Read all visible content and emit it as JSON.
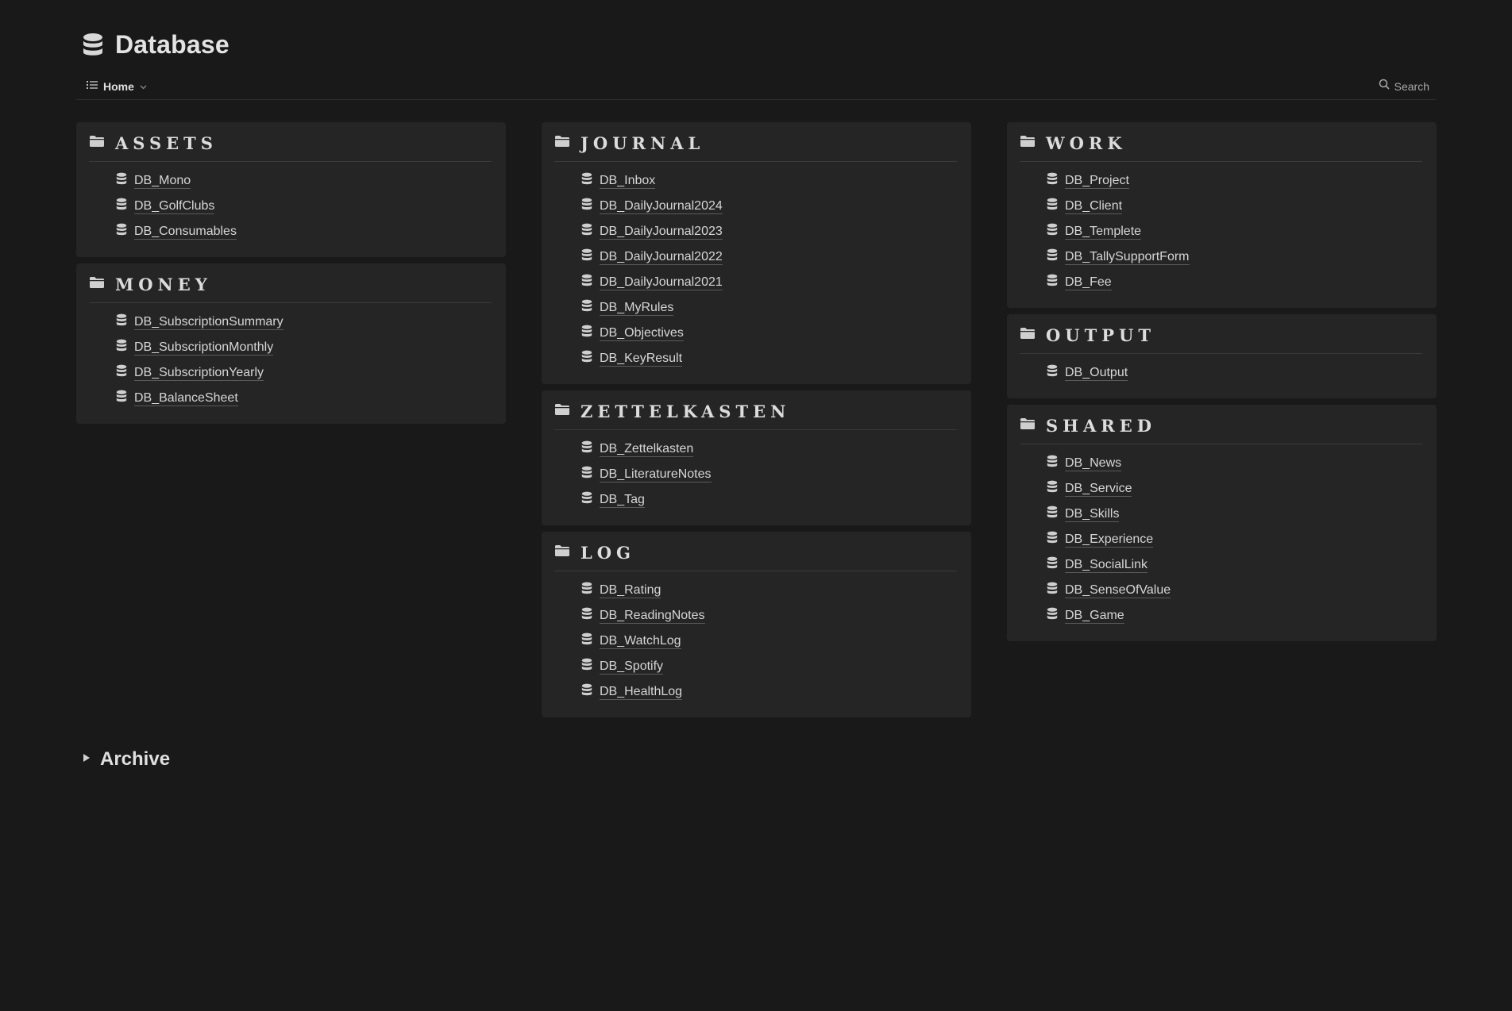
{
  "page": {
    "title": "Database",
    "icon": "database-icon"
  },
  "viewbar": {
    "tab_label": "Home",
    "tab_icon": "list-icon",
    "search_label": "Search",
    "search_icon": "search-icon"
  },
  "columns": [
    {
      "cards": [
        {
          "title": "ASSETS",
          "icon": "folder-icon",
          "items": [
            "DB_Mono",
            "DB_GolfClubs",
            "DB_Consumables"
          ]
        },
        {
          "title": "MONEY",
          "icon": "folder-icon",
          "items": [
            "DB_SubscriptionSummary",
            "DB_SubscriptionMonthly",
            "DB_SubscriptionYearly",
            "DB_BalanceSheet"
          ]
        }
      ]
    },
    {
      "cards": [
        {
          "title": "JOURNAL",
          "icon": "folder-icon",
          "items": [
            "DB_Inbox",
            "DB_DailyJournal2024",
            "DB_DailyJournal2023",
            "DB_DailyJournal2022",
            "DB_DailyJournal2021",
            "DB_MyRules",
            "DB_Objectives",
            "DB_KeyResult"
          ]
        },
        {
          "title": "ZETTELKASTEN",
          "icon": "folder-icon",
          "items": [
            "DB_Zettelkasten",
            "DB_LiteratureNotes",
            "DB_Tag"
          ]
        },
        {
          "title": "LOG",
          "icon": "folder-icon",
          "items": [
            "DB_Rating",
            "DB_ReadingNotes",
            "DB_WatchLog",
            "DB_Spotify",
            "DB_HealthLog"
          ]
        }
      ]
    },
    {
      "cards": [
        {
          "title": "WORK",
          "icon": "folder-icon",
          "items": [
            "DB_Project",
            "DB_Client",
            "DB_Templete",
            "DB_TallySupportForm",
            "DB_Fee"
          ]
        },
        {
          "title": "OUTPUT",
          "icon": "folder-icon",
          "items": [
            "DB_Output"
          ]
        },
        {
          "title": "SHARED",
          "icon": "folder-icon",
          "items": [
            "DB_News",
            "DB_Service",
            "DB_Skills",
            "DB_Experience",
            "DB_SocialLink",
            "DB_SenseOfValue",
            "DB_Game"
          ]
        }
      ]
    }
  ],
  "archive": {
    "label": "Archive",
    "icon": "triangle-right-icon"
  },
  "colors": {
    "background": "#191919",
    "card": "#252525",
    "text": "#d4d4d4",
    "divider": "#3a3a3a"
  }
}
